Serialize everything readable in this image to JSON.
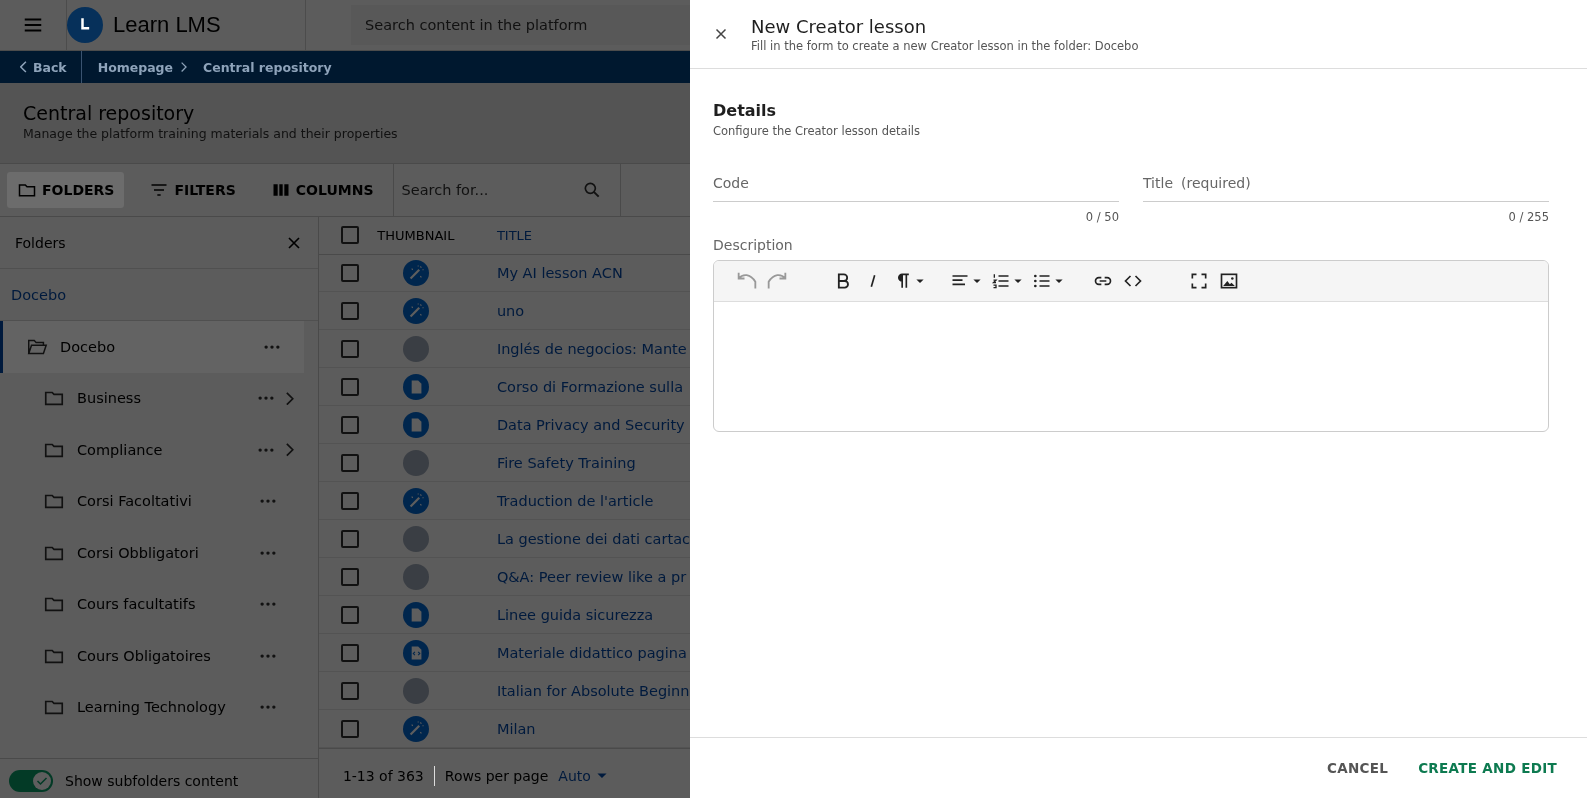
{
  "header": {
    "brand": "Learn LMS",
    "search_placeholder": "Search content in the platform"
  },
  "breadcrumb": {
    "back": "Back",
    "items": [
      "Homepage",
      "Central repository"
    ]
  },
  "page": {
    "title": "Central repository",
    "subtitle": "Manage the platform training materials and their properties"
  },
  "toolbar": {
    "buttons": [
      {
        "label": "FOLDERS",
        "kind": "folder",
        "selected": true
      },
      {
        "label": "FILTERS",
        "kind": "filter",
        "selected": false
      },
      {
        "label": "COLUMNS",
        "kind": "columns",
        "selected": false
      }
    ],
    "search_placeholder": "Search for..."
  },
  "folders": {
    "title": "Folders",
    "root": "Docebo",
    "tree": [
      {
        "label": "Docebo",
        "selected": true,
        "expanded": true,
        "children": [
          {
            "label": "Business",
            "has_children": true
          },
          {
            "label": "Compliance",
            "has_children": true
          },
          {
            "label": "Corsi Facoltativi",
            "has_children": false
          },
          {
            "label": "Corsi Obbligatori",
            "has_children": false
          },
          {
            "label": "Cours facultatifs",
            "has_children": false
          },
          {
            "label": "Cours Obligatoires",
            "has_children": false
          },
          {
            "label": "Learning Technology",
            "has_children": false
          }
        ]
      }
    ],
    "show_subfolders": {
      "label": "Show subfolders content",
      "on": true
    }
  },
  "table": {
    "columns": [
      "THUMBNAIL",
      "TITLE"
    ],
    "all_checked": false,
    "rows": [
      {
        "kind": "wand",
        "title": "My AI lesson ACN",
        "checked": false
      },
      {
        "kind": "wand",
        "title": "uno",
        "checked": false
      },
      {
        "kind": "photo",
        "title": "Inglés de negocios: Mante",
        "checked": false
      },
      {
        "kind": "doc",
        "title": "Corso di Formazione sulla",
        "checked": false
      },
      {
        "kind": "doc",
        "title": "Data Privacy and Security",
        "checked": false
      },
      {
        "kind": "photo",
        "title": "Fire Safety Training",
        "checked": false
      },
      {
        "kind": "wand",
        "title": "Traduction de l'article",
        "checked": false
      },
      {
        "kind": "photo",
        "title": "La gestione dei dati cartac",
        "checked": false
      },
      {
        "kind": "photo",
        "title": "Q&A: Peer review like a pr",
        "checked": false
      },
      {
        "kind": "doc",
        "title": "Linee guida sicurezza",
        "checked": false
      },
      {
        "kind": "code",
        "title": "Materiale didattico pagina",
        "checked": false
      },
      {
        "kind": "photo",
        "title": "Italian for Absolute Beginn",
        "checked": false
      },
      {
        "kind": "wand",
        "title": "Milan",
        "checked": false
      }
    ],
    "pagination": {
      "range": "1-13 of 363",
      "rows_label": "Rows per page",
      "rows_value": "Auto"
    }
  },
  "drawer": {
    "title": "New Creator lesson",
    "subtitle": "Fill in the form to create a new Creator lesson in the folder: Docebo",
    "section_title": "Details",
    "section_subtitle": "Configure the Creator lesson details",
    "fields": [
      {
        "label": "Code",
        "counter": "0 / 50"
      },
      {
        "label": "Title",
        "hint": "(required)",
        "counter": "0 / 255"
      }
    ],
    "description_label": "Description",
    "toolbar": [
      {
        "kind": "undo",
        "disabled": true
      },
      {
        "kind": "redo",
        "disabled": true
      },
      {
        "kind": "bold",
        "disabled": false
      },
      {
        "kind": "italic",
        "disabled": false
      },
      {
        "kind": "paragraph",
        "disabled": false
      },
      {
        "kind": "align",
        "disabled": false
      },
      {
        "kind": "ordered",
        "disabled": false
      },
      {
        "kind": "bullets",
        "disabled": false
      },
      {
        "kind": "link",
        "disabled": false
      },
      {
        "kind": "code",
        "disabled": false
      },
      {
        "kind": "fullscreen",
        "disabled": false
      },
      {
        "kind": "image",
        "disabled": false
      }
    ],
    "buttons": [
      {
        "label": "CANCEL",
        "kind": "secondary"
      },
      {
        "label": "CREATE AND EDIT",
        "kind": "primary"
      }
    ]
  }
}
